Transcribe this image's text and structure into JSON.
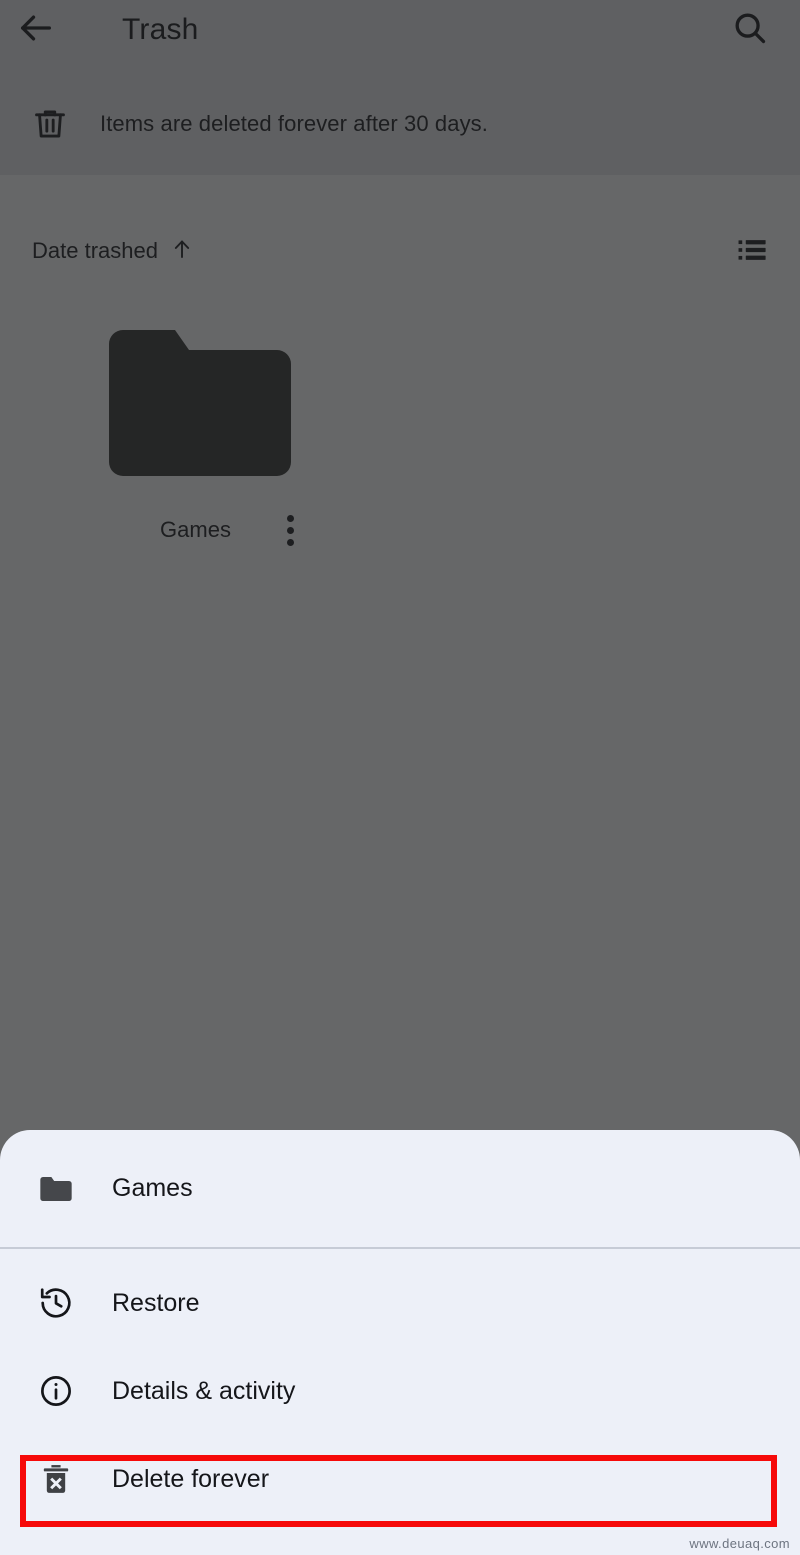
{
  "app": {
    "header": {
      "back_icon": "arrow-left-icon",
      "title": "Trash",
      "search_icon": "search-icon"
    },
    "banner": {
      "icon": "trash-icon",
      "text": "Items are deleted forever after 30 days."
    },
    "sortbar": {
      "sort_label": "Date trashed",
      "sort_direction_icon": "arrow-up-icon",
      "view_toggle_icon": "list-view-icon"
    },
    "grid": {
      "items": [
        {
          "name": "Games",
          "icon": "folder-icon",
          "overflow_icon": "more-vertical-icon"
        }
      ]
    }
  },
  "sheet": {
    "header": {
      "icon": "folder-icon",
      "title": "Games"
    },
    "menu": [
      {
        "label": "Restore",
        "icon": "history-restore-icon"
      },
      {
        "label": "Details & activity",
        "icon": "info-circle-icon"
      },
      {
        "label": "Delete forever",
        "icon": "delete-forever-icon"
      }
    ]
  },
  "annotation": {
    "highlight_color": "#f60a0a",
    "highlight_target": "Delete forever"
  },
  "watermark": {
    "text": "www.deuaq.com"
  }
}
